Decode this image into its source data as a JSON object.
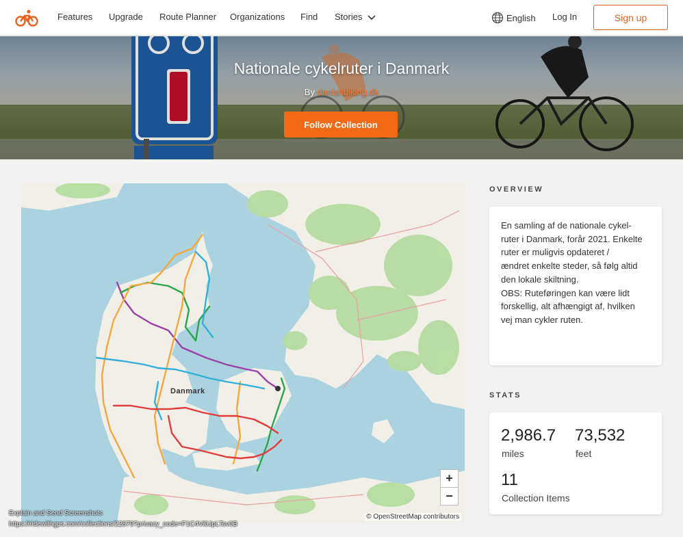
{
  "nav": {
    "items": [
      "Features",
      "Upgrade",
      "Route Planner",
      "Organizations",
      "Find",
      "Stories"
    ],
    "language": "English",
    "login": "Log In",
    "signup": "Sign up"
  },
  "hero": {
    "title": "Nationale cykelruter i Danmark",
    "by_prefix": "By",
    "author": "danishbiking.dk",
    "follow_button": "Follow Collection"
  },
  "map": {
    "country_label": "Danmark",
    "attribution": "© OpenStreetMap contributors",
    "zoom_in": "+",
    "zoom_out": "−",
    "route_colors": [
      "#9a3fa8",
      "#2aa64a",
      "#f4a73c",
      "#31b0d8",
      "#e03c3c"
    ]
  },
  "overlay": {
    "line1": "Explain and Send Screenshots",
    "line2": "https://ridewithgps.com/collections/22879?privacy_code=F1C4Vi0JpLTsv0B"
  },
  "overview": {
    "title": "OVERVIEW",
    "text": "En samling af de nationale cykel-\nruter i Danmark, forår 2021. Enkelte\nruter er muligvis opdateret /\nændret enkelte steder, så følg altid\nden lokale skiltning.\nOBS: Ruteføringen kan være lidt\nforskellig, alt afhængigt af, hvilken\nvej man cykler ruten."
  },
  "stats": {
    "title": "STATS",
    "distance_value": "2,986.7",
    "distance_unit": "miles",
    "elevation_value": "73,532",
    "elevation_unit": "feet",
    "items_value": "11",
    "items_label": "Collection Items"
  },
  "colors": {
    "brand_orange": "#f26a15",
    "signup_border": "#e35f1e",
    "water": "#aad3df",
    "land": "#f2efe9",
    "forest": "#b5dca0"
  }
}
